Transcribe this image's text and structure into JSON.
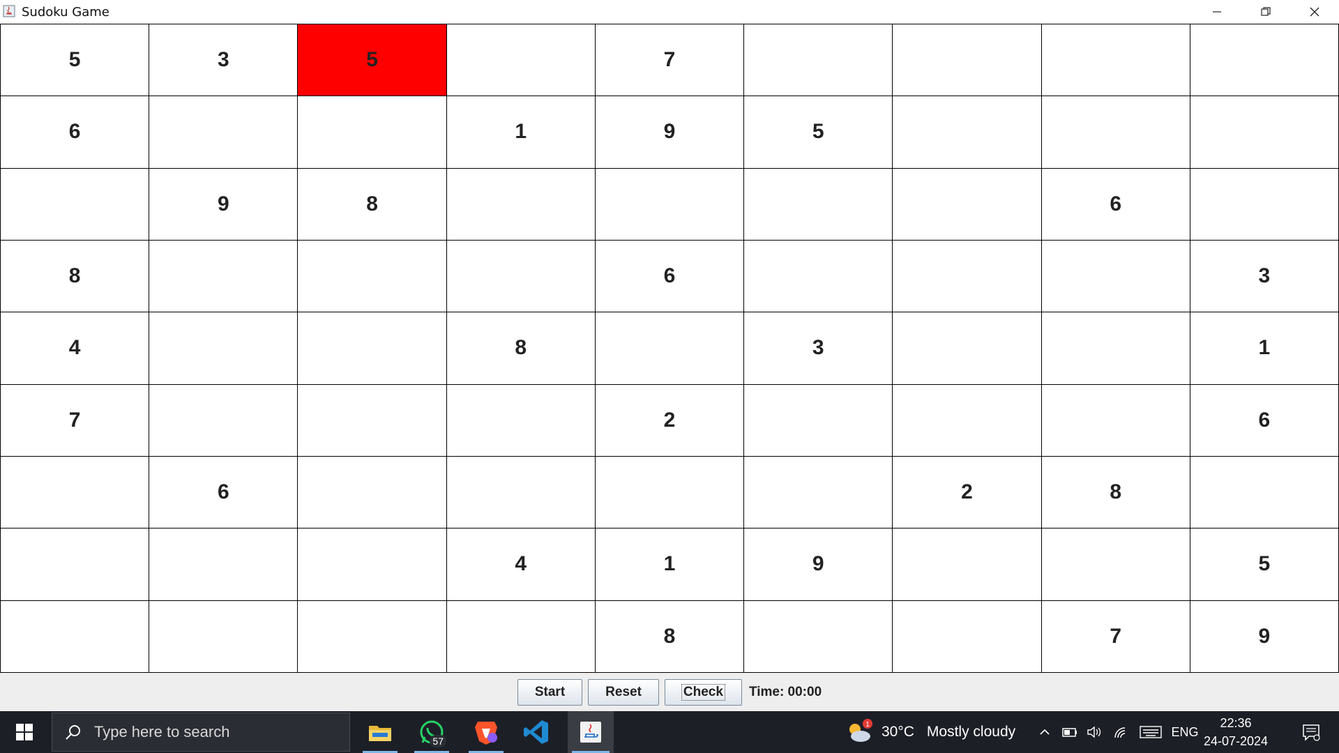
{
  "window": {
    "title": "Sudoku Game",
    "minimize_icon": "minimize-icon",
    "maximize_icon": "restore-icon",
    "close_icon": "close-icon"
  },
  "grid": {
    "highlight_color": "#ff0000",
    "rows": [
      [
        "5",
        "3",
        "5",
        "",
        "7",
        "",
        "",
        "",
        ""
      ],
      [
        "6",
        "",
        "",
        "1",
        "9",
        "5",
        "",
        "",
        ""
      ],
      [
        "",
        "9",
        "8",
        "",
        "",
        "",
        "",
        "6",
        ""
      ],
      [
        "8",
        "",
        "",
        "",
        "6",
        "",
        "",
        "",
        "3"
      ],
      [
        "4",
        "",
        "",
        "8",
        "",
        "3",
        "",
        "",
        "1"
      ],
      [
        "7",
        "",
        "",
        "",
        "2",
        "",
        "",
        "",
        "6"
      ],
      [
        "",
        "6",
        "",
        "",
        "",
        "",
        "2",
        "8",
        ""
      ],
      [
        "",
        "",
        "",
        "4",
        "1",
        "9",
        "",
        "",
        "5"
      ],
      [
        "",
        "",
        "",
        "",
        "8",
        "",
        "",
        "7",
        "9"
      ]
    ],
    "highlighted_cell": {
      "row": 0,
      "col": 2
    }
  },
  "controls": {
    "start_label": "Start",
    "reset_label": "Reset",
    "check_label": "Check",
    "timer_text": "Time: 00:00"
  },
  "taskbar": {
    "search_placeholder": "Type here to search",
    "whatsapp_badge": "57",
    "weather_temp": "30°C",
    "weather_condition": "Mostly cloudy",
    "weather_alert": "1",
    "language": "ENG",
    "time": "22:36",
    "date": "24-07-2024",
    "apps": [
      "file-explorer-icon",
      "whatsapp-icon",
      "brave-browser-icon",
      "vscode-icon",
      "java-icon"
    ]
  }
}
